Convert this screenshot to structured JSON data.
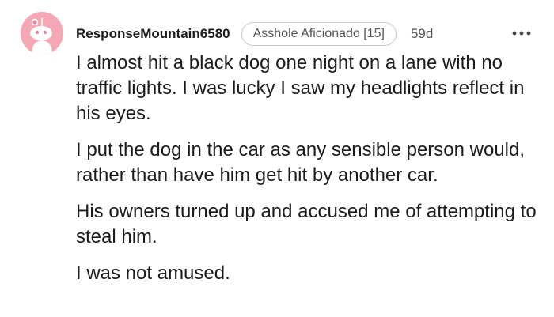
{
  "comment": {
    "author": "ResponseMountain6580",
    "flair": "Asshole Aficionado [15]",
    "age": "59d",
    "paragraphs": [
      "I almost hit a black dog one night on a lane with no traffic lights. I was lucky I saw my headlights reflect in his eyes.",
      "I put the dog in the car as any sensible person would, rather than have him get hit by another car.",
      "His owners turned up and accused me of attempting to steal him.",
      "I was not amused."
    ]
  },
  "icons": {
    "avatar": "snoo-avatar-icon",
    "more": "more-options-icon"
  },
  "colors": {
    "avatar_bg": "#f6a7b5",
    "text": "#1c1c1c",
    "muted": "#555555"
  }
}
